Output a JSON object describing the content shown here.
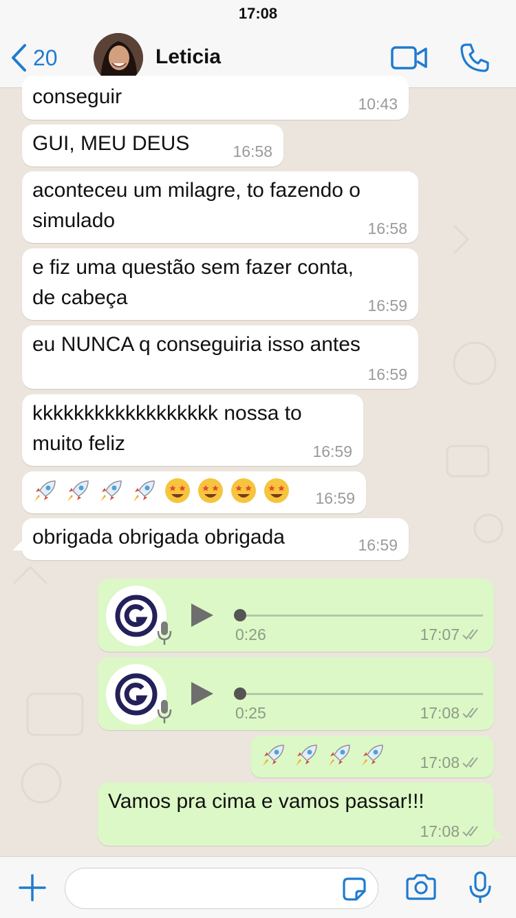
{
  "status_bar": {
    "time": "17:08"
  },
  "header": {
    "back_count": "20",
    "contact_name": "Leticia",
    "accent_color": "#1f7bd0"
  },
  "icons": {
    "back": "chevron-left-icon",
    "video": "video-camera-icon",
    "call": "phone-icon",
    "add": "plus-icon",
    "sticker": "sticker-icon",
    "camera": "camera-icon",
    "microphone": "microphone-icon",
    "read": "double-check-icon"
  },
  "messages": [
    {
      "direction": "in",
      "lines": [
        "conseguir"
      ],
      "time": "10:43"
    },
    {
      "direction": "in",
      "lines": [
        "GUI, MEU DEUS"
      ],
      "time": "16:58"
    },
    {
      "direction": "in",
      "lines": [
        "aconteceu um milagre, to fazendo o",
        "simulado"
      ],
      "time": "16:58"
    },
    {
      "direction": "in",
      "lines": [
        "e fiz uma questão sem fazer conta,",
        "de cabeça"
      ],
      "time": "16:59"
    },
    {
      "direction": "in",
      "lines": [
        "eu NUNCA q conseguiria isso antes"
      ],
      "time": "16:59"
    },
    {
      "direction": "in",
      "lines": [
        "kkkkkkkkkkkkkkkkkk nossa to",
        "muito feliz"
      ],
      "time": "16:59"
    },
    {
      "direction": "in",
      "emoji": [
        "rocket",
        "rocket",
        "rocket",
        "rocket",
        "star-struck",
        "star-struck",
        "star-struck",
        "star-struck"
      ],
      "time": "16:59"
    },
    {
      "direction": "in",
      "lines": [
        "obrigada obrigada obrigada"
      ],
      "time": "16:59"
    },
    {
      "direction": "out",
      "type": "voice",
      "duration": "0:26",
      "time": "17:07",
      "progress": 0
    },
    {
      "direction": "out",
      "type": "voice",
      "duration": "0:25",
      "time": "17:08",
      "progress": 0
    },
    {
      "direction": "out",
      "emoji": [
        "rocket",
        "rocket",
        "rocket",
        "rocket"
      ],
      "time": "17:08"
    },
    {
      "direction": "out",
      "lines": [
        "Vamos pra cima e vamos passar!!!"
      ],
      "time": "17:08"
    }
  ],
  "composer": {
    "placeholder": ""
  },
  "colors": {
    "chat_background": "#ece5dd",
    "incoming_bubble": "#ffffff",
    "outgoing_bubble": "#dcf8c6",
    "voice_logo": "#23205a"
  }
}
